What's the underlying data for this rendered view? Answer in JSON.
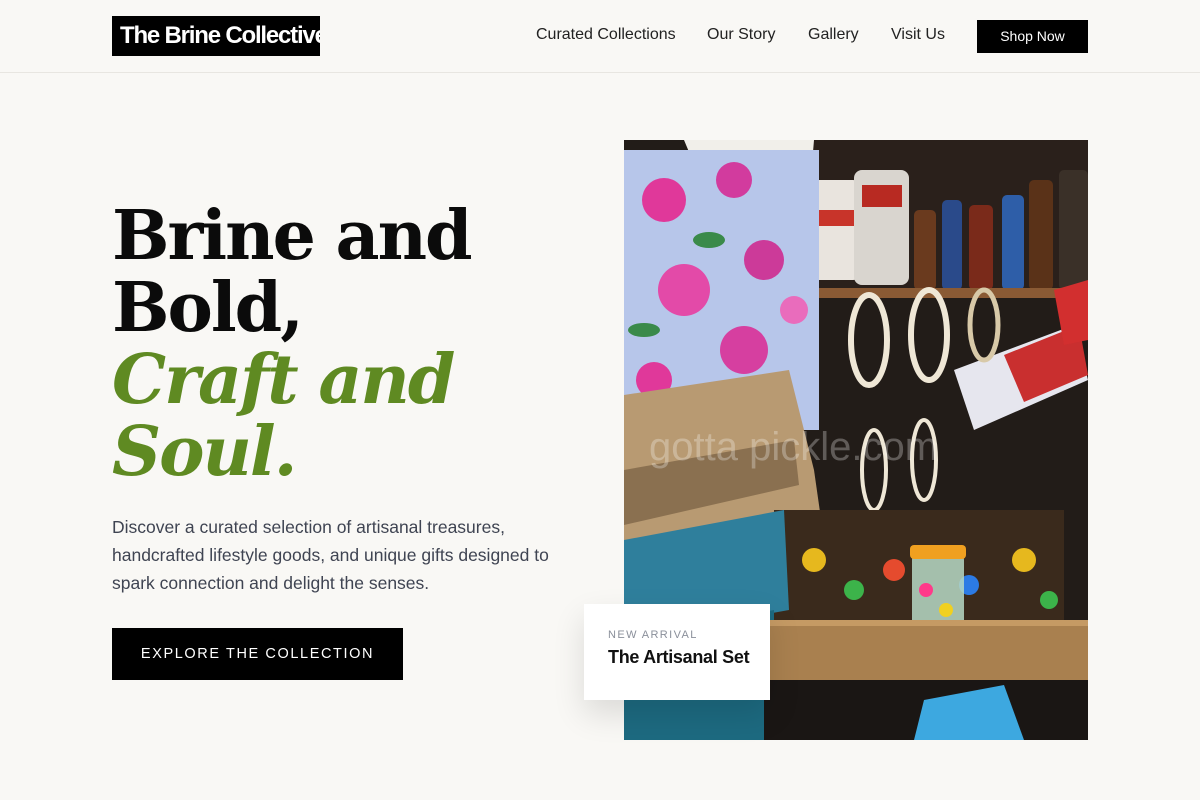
{
  "header": {
    "logo_text": "The Brine Collective",
    "nav": [
      {
        "label": "Curated Collections"
      },
      {
        "label": "Our Story"
      },
      {
        "label": "Gallery"
      },
      {
        "label": "Visit Us"
      }
    ],
    "shop_label": "Shop Now"
  },
  "hero": {
    "headline_line1": "Brine and",
    "headline_line2": "Bold,",
    "headline_accent_line1": "Craft and",
    "headline_accent_line2": "Soul.",
    "description": "Discover a curated selection of artisanal treasures, handcrafted lifestyle goods, and unique gifts designed to spark connection and delight the senses.",
    "cta_label": "EXPLORE THE COLLECTION",
    "image_watermark": "gotta pickle.com"
  },
  "feature_card": {
    "eyebrow": "NEW ARRIVAL",
    "title": "The Artisanal Set"
  },
  "colors": {
    "background": "#f9f8f5",
    "accent_green": "#5f8a22",
    "black": "#000000",
    "body_text": "#3f4452"
  }
}
